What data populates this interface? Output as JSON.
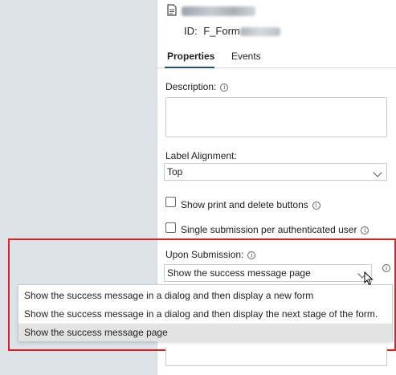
{
  "header": {
    "id_label": "ID:",
    "id_value": "F_Form"
  },
  "tabs": [
    {
      "label": "Properties"
    },
    {
      "label": "Events"
    }
  ],
  "description": {
    "label": "Description:",
    "value": ""
  },
  "label_alignment": {
    "label": "Label Alignment:",
    "value": "Top"
  },
  "checkboxes": [
    {
      "label": "Show print and delete buttons",
      "checked": false
    },
    {
      "label": "Single submission per authenticated user",
      "checked": false
    }
  ],
  "upon_submission": {
    "label": "Upon Submission:",
    "value": "Show the success message page",
    "options": [
      "Show the success message in a dialog and then display a new form",
      "Show the success message in a dialog and then display the next stage of the form.",
      "Show the success message page"
    ],
    "selected_index": 2
  },
  "colors": {
    "highlight_border": "#e02020",
    "tab_underline": "#2a4e6e",
    "selected_option_bg": "#e3e3e3"
  }
}
